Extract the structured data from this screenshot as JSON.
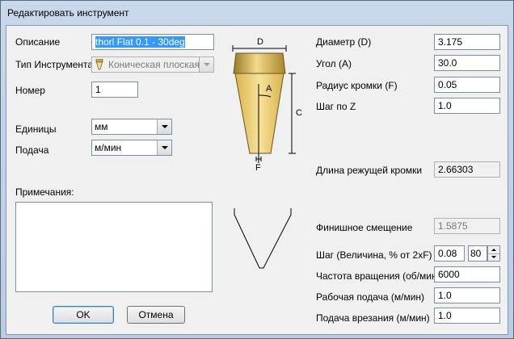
{
  "window": {
    "title": "Редактировать инструмент"
  },
  "left": {
    "description_label": "Описание",
    "description_value": "thorl Flat 0.1 - 30deg",
    "tool_type_label": "Тип Инструмента",
    "tool_type_value": "Коническая плоская",
    "number_label": "Номер",
    "number_value": "1",
    "units_label": "Единицы",
    "units_value": "мм",
    "feed_label": "Подача",
    "feed_value": "м/мин",
    "notes_label": "Примечания:"
  },
  "diagram": {
    "label_d": "D",
    "label_a": "A",
    "label_c": "C",
    "label_f": "F"
  },
  "right": {
    "diameter_label": "Диаметр (D)",
    "diameter_value": "3.175",
    "angle_label": "Угол (A)",
    "angle_value": "30.0",
    "radius_label": "Радиус кромки (F)",
    "radius_value": "0.05",
    "zstep_label": "Шаг по Z",
    "zstep_value": "1.0",
    "flute_label": "Длина режущей кромки",
    "flute_value": "2.66303",
    "finish_label": "Финишное смещение",
    "finish_value": "1.5875",
    "stepover_label": "Шаг (Величина, % от 2xF)",
    "stepover_value": "0.08",
    "stepover_percent": "80",
    "spindle_label": "Частота вращения (об/мин)",
    "spindle_value": "6000",
    "feedrate_label": "Рабочая подача (м/мин)",
    "feedrate_value": "1.0",
    "plunge_label": "Подача врезания (м/мин)",
    "plunge_value": "1.0"
  },
  "buttons": {
    "ok": "OK",
    "cancel": "Отмена"
  }
}
